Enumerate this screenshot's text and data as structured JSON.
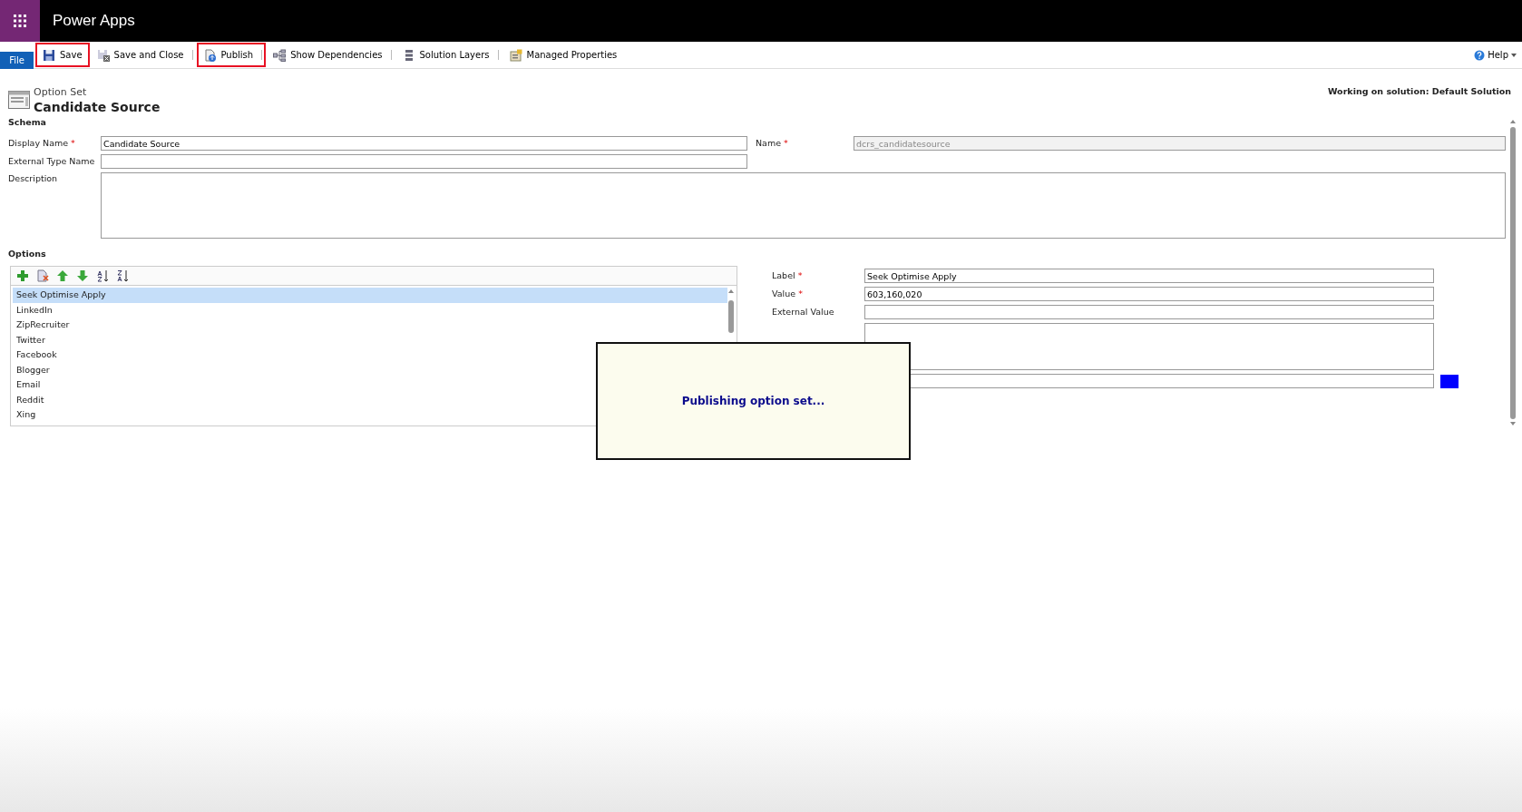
{
  "app": {
    "title": "Power Apps"
  },
  "toolbar": {
    "file_tab": "File",
    "buttons": [
      {
        "label": "Save",
        "highlighted": true,
        "separator_after": false
      },
      {
        "label": "Save and Close",
        "highlighted": false,
        "separator_after": true
      },
      {
        "label": "Publish",
        "highlighted": true,
        "separator_after": true
      },
      {
        "label": "Show Dependencies",
        "highlighted": false,
        "separator_after": true
      },
      {
        "label": "Solution Layers",
        "highlighted": false,
        "separator_after": true
      },
      {
        "label": "Managed Properties",
        "highlighted": false,
        "separator_after": false
      }
    ],
    "help": "Help"
  },
  "header": {
    "type_label": "Option Set",
    "title": "Candidate Source",
    "solution": "Working on solution: Default Solution"
  },
  "schema": {
    "heading": "Schema",
    "display_name": {
      "label": "Display Name",
      "required_mark": "*",
      "value": "Candidate Source"
    },
    "name": {
      "label": "Name",
      "required_mark": "*",
      "value": "dcrs_candidatesource",
      "disabled": true
    },
    "external_type_name": {
      "label": "External Type Name"
    },
    "description": {
      "label": "Description"
    }
  },
  "options": {
    "heading": "Options",
    "items": [
      {
        "label": "Seek Optimise Apply",
        "selected": true
      },
      {
        "label": "LinkedIn",
        "selected": false
      },
      {
        "label": "ZipRecruiter",
        "selected": false
      },
      {
        "label": "Twitter",
        "selected": false
      },
      {
        "label": "Facebook",
        "selected": false
      },
      {
        "label": "Blogger",
        "selected": false
      },
      {
        "label": "Email",
        "selected": false
      },
      {
        "label": "Reddit",
        "selected": false
      },
      {
        "label": "Xing",
        "selected": false
      }
    ],
    "detail": {
      "label": {
        "label": "Label",
        "required_mark": "*",
        "value": "Seek Optimise Apply"
      },
      "value": {
        "label": "Value",
        "required_mark": "*",
        "value": "603,160,020"
      },
      "external_value": {
        "label": "External Value"
      },
      "color": "#0000ff"
    }
  },
  "dialog": {
    "message": "Publishing option set..."
  }
}
